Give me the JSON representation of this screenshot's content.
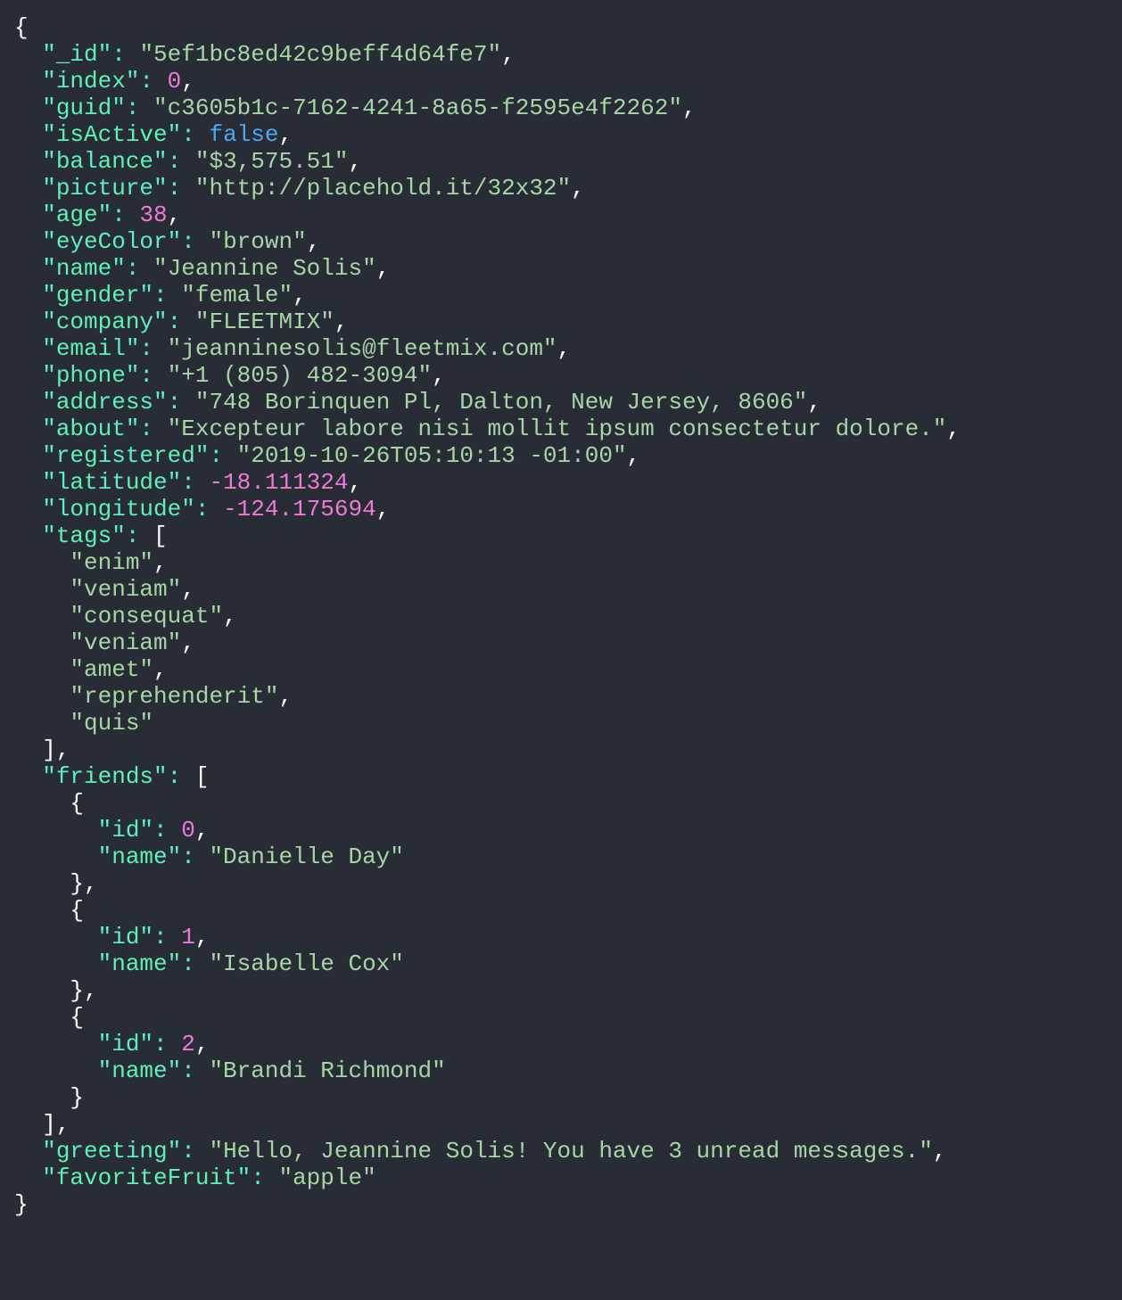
{
  "theme": {
    "background": "#282c34",
    "key_color": "#5ef0b8",
    "string_color": "#a8d5a8",
    "number_color": "#ee7ad8",
    "boolean_color": "#4ea8f0",
    "punctuation_color": "#ffffff"
  },
  "document": {
    "_id": "5ef1bc8ed42c9beff4d64fe7",
    "index": 0,
    "guid": "c3605b1c-7162-4241-8a65-f2595e4f2262",
    "isActive": false,
    "balance": "$3,575.51",
    "picture": "http://placehold.it/32x32",
    "age": 38,
    "eyeColor": "brown",
    "name": "Jeannine Solis",
    "gender": "female",
    "company": "FLEETMIX",
    "email": "jeanninesolis@fleetmix.com",
    "phone": "+1 (805) 482-3094",
    "address": "748 Borinquen Pl, Dalton, New Jersey, 8606",
    "about": "Excepteur labore nisi mollit ipsum consectetur dolore.",
    "registered": "2019-10-26T05:10:13 -01:00",
    "latitude": -18.111324,
    "longitude": -124.175694,
    "tags": [
      "enim",
      "veniam",
      "consequat",
      "veniam",
      "amet",
      "reprehenderit",
      "quis"
    ],
    "friends": [
      {
        "id": 0,
        "name": "Danielle Day"
      },
      {
        "id": 1,
        "name": "Isabelle Cox"
      },
      {
        "id": 2,
        "name": "Brandi Richmond"
      }
    ],
    "greeting": "Hello, Jeannine Solis! You have 3 unread messages.",
    "favoriteFruit": "apple"
  }
}
